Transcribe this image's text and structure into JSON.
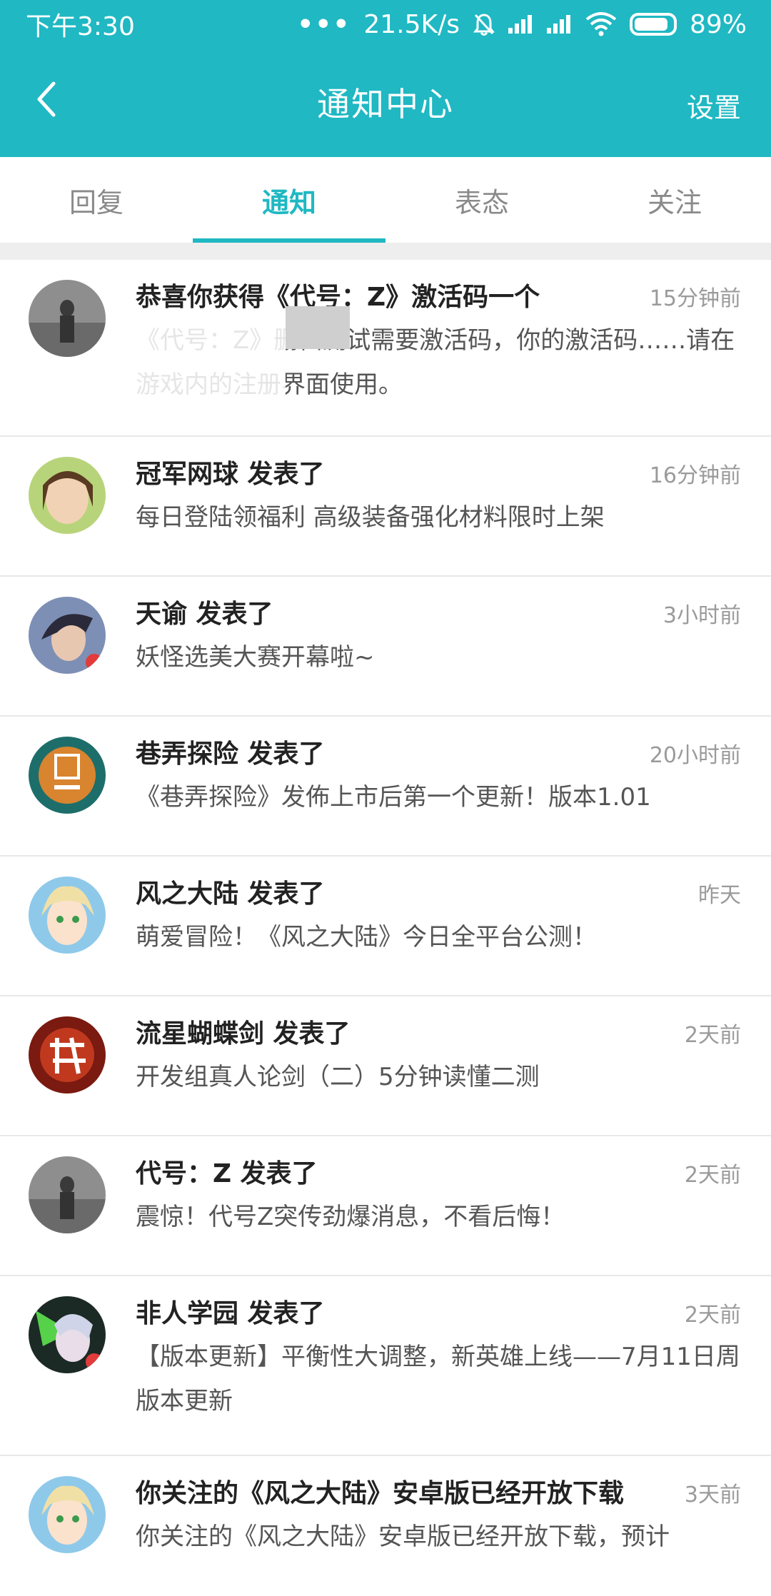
{
  "status_bar": {
    "time": "下午3:30",
    "speed": "21.5K/s",
    "battery": "89%",
    "battery_level": 0.89
  },
  "header": {
    "title": "通知中心",
    "back_icon": "chevron-left-icon",
    "settings_label": "设置"
  },
  "tabs": [
    {
      "label": "回复",
      "active": false
    },
    {
      "label": "通知",
      "active": true
    },
    {
      "label": "表态",
      "active": false
    },
    {
      "label": "关注",
      "active": false
    }
  ],
  "notifications": [
    {
      "title": "恭喜你获得《代号：Z》激活码一个",
      "time": "15分钟前",
      "body": "《代号：Z》删档测试需要激活码，你的激活码……请在游戏内的注册界面使用。"
    },
    {
      "title": "冠军网球 发表了",
      "time": "16分钟前",
      "body": "每日登陆领福利 高级装备强化材料限时上架"
    },
    {
      "title": "天谕 发表了",
      "time": "3小时前",
      "body": "妖怪选美大赛开幕啦~"
    },
    {
      "title": "巷弄探险 发表了",
      "time": "20小时前",
      "body": "《巷弄探险》发佈上市后第一个更新！版本1.01"
    },
    {
      "title": "风之大陆 发表了",
      "time": "昨天",
      "body": "萌爱冒险！《风之大陆》今日全平台公测！"
    },
    {
      "title": "流星蝴蝶剑 发表了",
      "time": "2天前",
      "body": "开发组真人论剑（二）5分钟读懂二测"
    },
    {
      "title": "代号：Z 发表了",
      "time": "2天前",
      "body": "震惊！代号Z突传劲爆消息，不看后悔！"
    },
    {
      "title": "非人学园 发表了",
      "time": "2天前",
      "body": "【版本更新】平衡性大调整，新英雄上线——7月11日周版本更新"
    },
    {
      "title": "你关注的《风之大陆》安卓版已经开放下载",
      "time": "3天前",
      "body": "你关注的《风之大陆》安卓版已经开放下载，预计"
    }
  ],
  "avatar_icons": [
    "zombie-game-avatar",
    "tennis-girl-avatar",
    "tianyu-hero-avatar",
    "alleys-logo-avatar",
    "anime-boy-avatar",
    "meteor-sword-avatar",
    "zombie-game-avatar",
    "anime-character-avatar",
    "anime-boy-avatar"
  ],
  "colors": {
    "accent": "#1fb8c3"
  }
}
